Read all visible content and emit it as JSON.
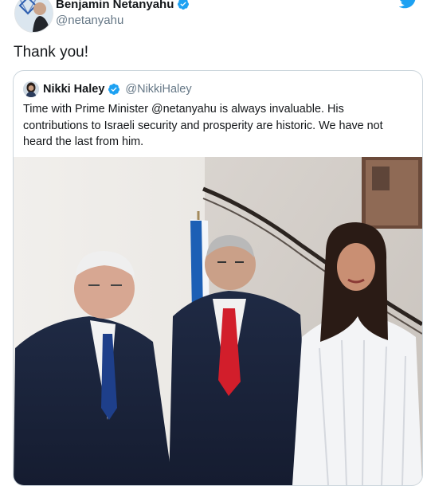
{
  "tweet": {
    "author_name": "Benjamin Netanyahu",
    "author_handle": "@netanyahu",
    "verified_icon": "verified-badge-icon",
    "brand_icon": "twitter-bird-icon",
    "text": "Thank you!"
  },
  "quoted_tweet": {
    "author_name": "Nikki Haley",
    "author_handle": "@NikkiHaley",
    "text_lines": [
      "Time with Prime Minister @netanyahu is always invaluable.  His",
      "contributions to Israeli security and prosperity are historic. We have not",
      "heard the last from him."
    ],
    "photo_icon": "photo-image"
  },
  "colors": {
    "twitter_blue": "#1da1f2",
    "text_primary": "#14171a",
    "text_secondary": "#657786",
    "border": "#ccd6dd"
  }
}
